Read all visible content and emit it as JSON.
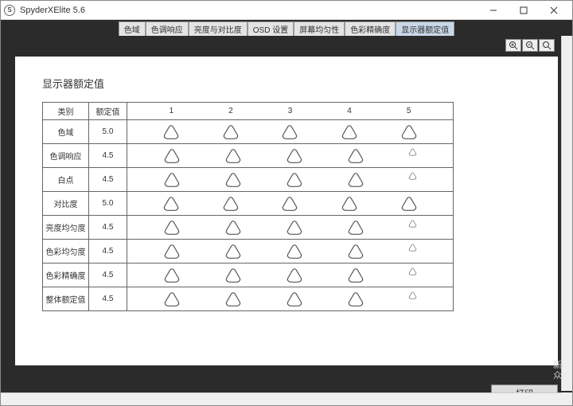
{
  "window": {
    "title": "SpyderXElite 5.6",
    "app_icon_letter": "S"
  },
  "tabs": [
    {
      "label": "色域"
    },
    {
      "label": "色调响应"
    },
    {
      "label": "亮度与对比度"
    },
    {
      "label": "OSD 设置"
    },
    {
      "label": "屏幕均匀性"
    },
    {
      "label": "色彩精确度"
    },
    {
      "label": "显示器额定值"
    }
  ],
  "active_tab_index": 6,
  "page": {
    "title": "显示器额定值"
  },
  "table": {
    "header": {
      "category": "类别",
      "value": "额定值",
      "scale": [
        "1",
        "2",
        "3",
        "4",
        "5"
      ]
    },
    "rows": [
      {
        "category": "色域",
        "value": "5.0",
        "score": 5.0
      },
      {
        "category": "色调响应",
        "value": "4.5",
        "score": 4.5
      },
      {
        "category": "白点",
        "value": "4.5",
        "score": 4.5
      },
      {
        "category": "对比度",
        "value": "5.0",
        "score": 5.0
      },
      {
        "category": "亮度均匀度",
        "value": "4.5",
        "score": 4.5
      },
      {
        "category": "色彩均匀度",
        "value": "4.5",
        "score": 4.5
      },
      {
        "category": "色彩精确度",
        "value": "4.5",
        "score": 4.5
      },
      {
        "category": "整体额定值",
        "value": "4.5",
        "score": 4.5
      }
    ]
  },
  "footer": {
    "print": "打印"
  },
  "watermark": {
    "line1": "新浪",
    "line2": "众测"
  },
  "chart_data": {
    "type": "table",
    "title": "显示器额定值",
    "columns": [
      "类别",
      "额定值"
    ],
    "rows": [
      [
        "色域",
        5.0
      ],
      [
        "色调响应",
        4.5
      ],
      [
        "白点",
        4.5
      ],
      [
        "对比度",
        5.0
      ],
      [
        "亮度均匀度",
        4.5
      ],
      [
        "色彩均匀度",
        4.5
      ],
      [
        "色彩精确度",
        4.5
      ],
      [
        "整体额定值",
        4.5
      ]
    ],
    "scale": [
      1,
      2,
      3,
      4,
      5
    ]
  }
}
